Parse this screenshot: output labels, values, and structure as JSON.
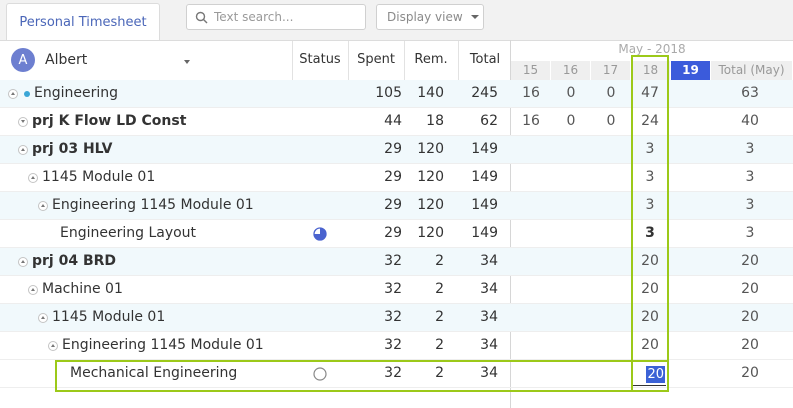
{
  "tab": {
    "label": "Personal Timesheet"
  },
  "search": {
    "placeholder": "Text search..."
  },
  "display_view": {
    "label": "Display view"
  },
  "user": {
    "initial": "A",
    "name": "Albert"
  },
  "columns": {
    "status": "Status",
    "spent": "Spent",
    "rem": "Rem.",
    "total": "Total"
  },
  "calendar": {
    "month": "May - 2018",
    "days": [
      "15",
      "16",
      "17",
      "18",
      "19"
    ],
    "total_label": "Total (May)",
    "today": "19"
  },
  "rows": [
    {
      "name": "Engineering",
      "spent": "105",
      "rem": "140",
      "total": "245",
      "d15": "16",
      "d16": "0",
      "d17": "0",
      "d18": "47",
      "month_total": "63"
    },
    {
      "name": "prj K Flow LD Const",
      "spent": "44",
      "rem": "18",
      "total": "62",
      "d15": "16",
      "d16": "0",
      "d17": "0",
      "d18": "24",
      "month_total": "40"
    },
    {
      "name": "prj 03 HLV",
      "spent": "29",
      "rem": "120",
      "total": "149",
      "d15": "",
      "d16": "",
      "d17": "",
      "d18": "3",
      "month_total": "3"
    },
    {
      "name": "1145 Module 01",
      "spent": "29",
      "rem": "120",
      "total": "149",
      "d15": "",
      "d16": "",
      "d17": "",
      "d18": "3",
      "month_total": "3"
    },
    {
      "name": "Engineering 1145 Module 01",
      "spent": "29",
      "rem": "120",
      "total": "149",
      "d15": "",
      "d16": "",
      "d17": "",
      "d18": "3",
      "month_total": "3"
    },
    {
      "name": "Engineering Layout",
      "spent": "29",
      "rem": "120",
      "total": "149",
      "d15": "",
      "d16": "",
      "d17": "",
      "d18": "3",
      "month_total": "3",
      "status": "partial-pie-icon"
    },
    {
      "name": "prj 04 BRD",
      "spent": "32",
      "rem": "2",
      "total": "34",
      "d15": "",
      "d16": "",
      "d17": "",
      "d18": "20",
      "month_total": "20"
    },
    {
      "name": "Machine 01",
      "spent": "32",
      "rem": "2",
      "total": "34",
      "d15": "",
      "d16": "",
      "d17": "",
      "d18": "20",
      "month_total": "20"
    },
    {
      "name": "1145 Module 01",
      "spent": "32",
      "rem": "2",
      "total": "34",
      "d15": "",
      "d16": "",
      "d17": "",
      "d18": "20",
      "month_total": "20"
    },
    {
      "name": "Engineering 1145 Module 01",
      "spent": "32",
      "rem": "2",
      "total": "34",
      "d15": "",
      "d16": "",
      "d17": "",
      "d18": "20",
      "month_total": "20"
    },
    {
      "name": "Mechanical Engineering",
      "spent": "32",
      "rem": "2",
      "total": "34",
      "d15": "",
      "d16": "",
      "d17": "",
      "d18": "20",
      "month_total": "20",
      "status": "empty-circle-icon"
    }
  ],
  "colors": {
    "accent": "#3b5bdb",
    "highlight": "#9cc919",
    "alt_row": "#f1f9fc",
    "bullet": "#3aa6d6"
  }
}
